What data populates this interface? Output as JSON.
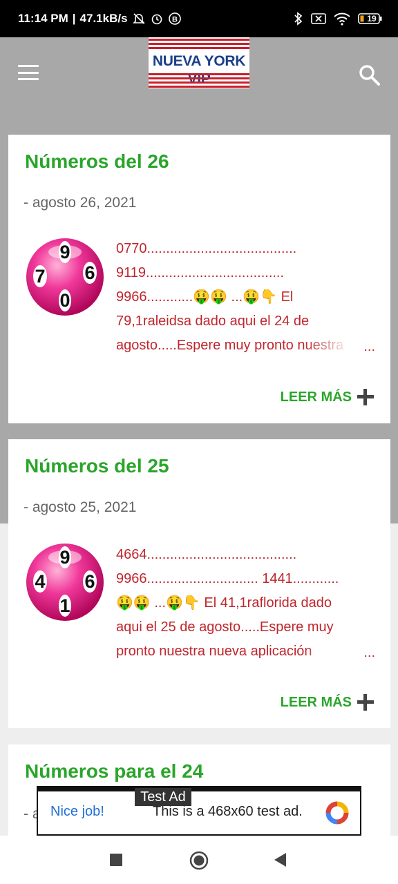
{
  "status_bar": {
    "time": "11:14 PM",
    "separator": "|",
    "speed": "47.1kB/s",
    "battery": "19"
  },
  "header": {
    "logo_text": "NUEVA YORK VIP"
  },
  "posts": [
    {
      "title": "Números del 26",
      "date": "- agosto 26, 2021",
      "ball_numbers": [
        "9",
        "7",
        "6",
        "0"
      ],
      "snippet_lines": [
        "0770.......................................",
        "9119....................................",
        "9966............🤑🤑 ...🤑👇 El",
        "79,1raleidsa dado aqui el 24 de",
        "agosto.....Espere muy pronto nuestra"
      ],
      "ellipsis": "...",
      "read_more": "LEER MÁS"
    },
    {
      "title": "Números del 25",
      "date": "- agosto 25, 2021",
      "ball_numbers": [
        "9",
        "4",
        "6",
        "1"
      ],
      "snippet_lines": [
        "4664.......................................",
        "9966............................. 1441............",
        "🤑🤑 ...🤑👇 El 41,1raflorida dado",
        "aqui el 25 de agosto.....Espere muy",
        "pronto nuestra nueva aplicación"
      ],
      "ellipsis": "...",
      "read_more": "LEER MÁS"
    },
    {
      "title": "Números para el 24",
      "date": "- a"
    }
  ],
  "ad": {
    "label": "Test Ad",
    "nice": "Nice job!",
    "text": "This is a 468x60 test ad."
  },
  "colors": {
    "title_green": "#2aa52a",
    "snippet_red": "#c0262d",
    "header_gray": "#a8a8a8",
    "ball_pink": "#e8157a"
  }
}
